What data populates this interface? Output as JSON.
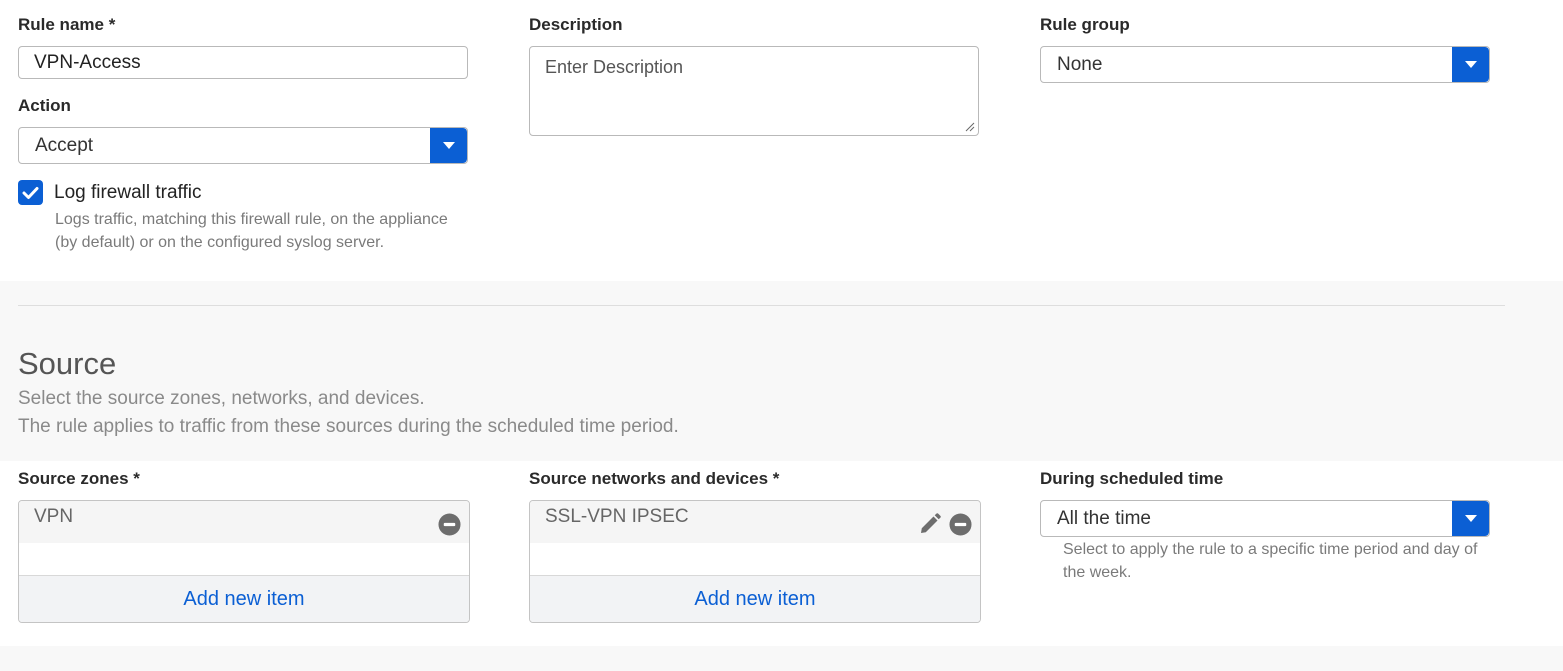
{
  "general": {
    "rule_name_label": "Rule name *",
    "rule_name_value": "VPN-Access",
    "description_label": "Description",
    "description_placeholder": "Enter Description",
    "rule_group_label": "Rule group",
    "rule_group_value": "None",
    "action_label": "Action",
    "action_value": "Accept",
    "log_label": "Log firewall traffic",
    "log_checked": true,
    "log_help_line1": "Logs traffic, matching this firewall rule, on the appliance",
    "log_help_line2": "(by default) or on the configured syslog server."
  },
  "source": {
    "title": "Source",
    "desc_line1": "Select the source zones, networks, and devices.",
    "desc_line2": "The rule applies to traffic from these sources during the scheduled time period.",
    "zones_label": "Source zones *",
    "zones_items": [
      "VPN"
    ],
    "zones_add_label": "Add new item",
    "networks_label": "Source networks and devices *",
    "networks_items": [
      "SSL-VPN IPSEC"
    ],
    "networks_add_label": "Add new item",
    "schedule_label": "During scheduled time",
    "schedule_value": "All the time",
    "schedule_help_line1": "Select to apply the rule to a specific time period and day of",
    "schedule_help_line2": "the week."
  },
  "icons": {
    "dropdown": "chevron-down-icon",
    "checkbox": "checkmark-icon",
    "remove": "minus-circle-icon",
    "edit": "pencil-icon"
  },
  "colors": {
    "accent": "#0b5fd4",
    "link": "#0b5fd4"
  }
}
